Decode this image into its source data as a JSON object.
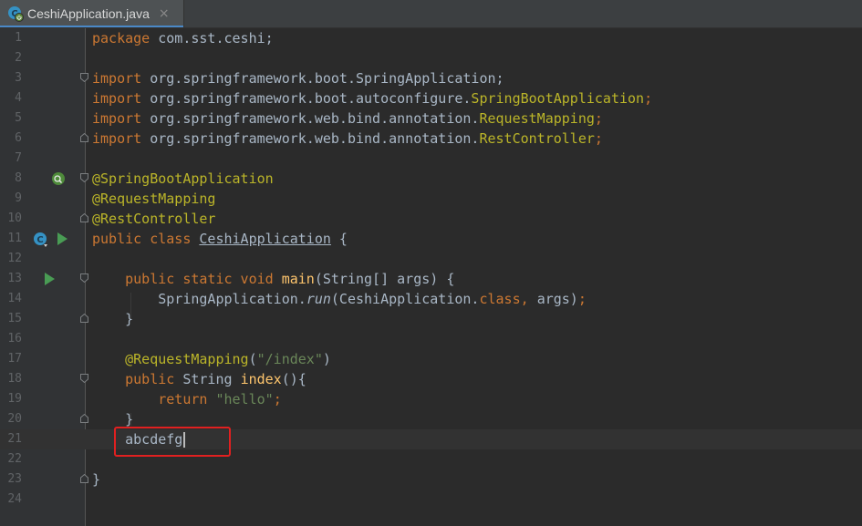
{
  "tab": {
    "title": "CeshiApplication.java",
    "close": "×"
  },
  "colors": {
    "background": "#2b2b2b",
    "gutter": "#313335",
    "keyword": "#cc7832",
    "annotation": "#bbb529",
    "string": "#6a8759",
    "function": "#ffc66d",
    "text": "#a9b7c6",
    "highlight": "#e02020",
    "run": "#499c54"
  },
  "lines": [
    {
      "n": "1",
      "tokens": [
        [
          "kw",
          "package "
        ],
        [
          "",
          "com.sst.ceshi;"
        ]
      ]
    },
    {
      "n": "2",
      "tokens": []
    },
    {
      "n": "3",
      "tokens": [
        [
          "kw",
          "import "
        ],
        [
          "",
          "org.springframework.boot.SpringApplication;"
        ]
      ]
    },
    {
      "n": "4",
      "tokens": [
        [
          "kw",
          "import "
        ],
        [
          "",
          "org.springframework.boot.autoconfigure."
        ],
        [
          "ann",
          "SpringBootApplication"
        ],
        [
          "kw",
          ";"
        ]
      ]
    },
    {
      "n": "5",
      "tokens": [
        [
          "kw",
          "import "
        ],
        [
          "",
          "org.springframework.web.bind.annotation."
        ],
        [
          "ann",
          "RequestMapping"
        ],
        [
          "kw",
          ";"
        ]
      ]
    },
    {
      "n": "6",
      "tokens": [
        [
          "kw",
          "import "
        ],
        [
          "",
          "org.springframework.web.bind.annotation."
        ],
        [
          "ann",
          "RestController"
        ],
        [
          "kw",
          ";"
        ]
      ]
    },
    {
      "n": "7",
      "tokens": []
    },
    {
      "n": "8",
      "tokens": [
        [
          "ann",
          "@SpringBootApplication"
        ]
      ]
    },
    {
      "n": "9",
      "tokens": [
        [
          "ann",
          "@RequestMapping"
        ]
      ]
    },
    {
      "n": "10",
      "tokens": [
        [
          "ann",
          "@RestController"
        ]
      ]
    },
    {
      "n": "11",
      "tokens": [
        [
          "kw",
          "public class "
        ],
        [
          "ul",
          "CeshiApplication"
        ],
        [
          "",
          " {"
        ]
      ]
    },
    {
      "n": "12",
      "tokens": []
    },
    {
      "n": "13",
      "tokens": [
        [
          "",
          "    "
        ],
        [
          "kw",
          "public static void "
        ],
        [
          "fn",
          "main"
        ],
        [
          "",
          "(String[] args) {"
        ]
      ]
    },
    {
      "n": "14",
      "tokens": [
        [
          "",
          "        SpringApplication."
        ],
        [
          "it",
          "run"
        ],
        [
          "",
          "(CeshiApplication."
        ],
        [
          "kw",
          "class, "
        ],
        [
          "",
          "args)"
        ],
        [
          "kw",
          ";"
        ]
      ]
    },
    {
      "n": "15",
      "tokens": [
        [
          "",
          "    }"
        ]
      ]
    },
    {
      "n": "16",
      "tokens": []
    },
    {
      "n": "17",
      "tokens": [
        [
          "",
          "    "
        ],
        [
          "ann",
          "@RequestMapping"
        ],
        [
          "",
          "("
        ],
        [
          "str",
          "\"/index\""
        ],
        [
          "",
          ")"
        ]
      ]
    },
    {
      "n": "18",
      "tokens": [
        [
          "",
          "    "
        ],
        [
          "kw",
          "public "
        ],
        [
          "",
          "String "
        ],
        [
          "fn",
          "index"
        ],
        [
          "",
          "(){"
        ]
      ]
    },
    {
      "n": "19",
      "tokens": [
        [
          "",
          "        "
        ],
        [
          "kw",
          "return "
        ],
        [
          "str",
          "\"hello\""
        ],
        [
          "kw",
          ";"
        ]
      ]
    },
    {
      "n": "20",
      "tokens": [
        [
          "",
          "    }"
        ]
      ]
    },
    {
      "n": "21",
      "tokens": [
        [
          "",
          "    abcdefg"
        ]
      ]
    },
    {
      "n": "22",
      "tokens": []
    },
    {
      "n": "23",
      "tokens": [
        [
          "",
          "}"
        ]
      ]
    },
    {
      "n": "24",
      "tokens": []
    }
  ]
}
